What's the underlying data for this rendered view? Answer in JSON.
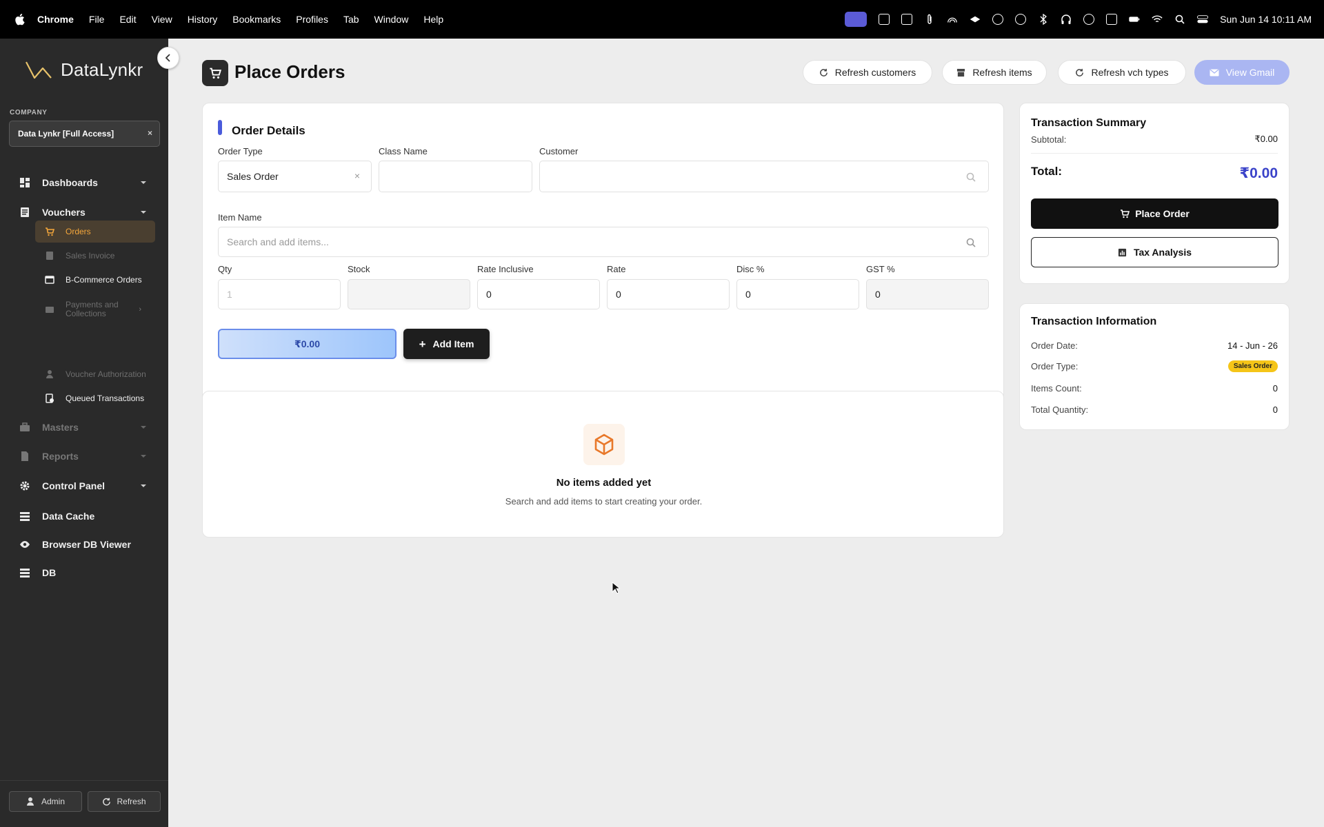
{
  "menubar": {
    "app": "Chrome",
    "items": [
      "File",
      "Edit",
      "View",
      "History",
      "Bookmarks",
      "Profiles",
      "Tab",
      "Window",
      "Help"
    ],
    "clock": "Sun Jun 14  10:11 AM"
  },
  "sidebar": {
    "brand": "DataLynkr",
    "company_label": "COMPANY",
    "company_value": "Data Lynkr [Full Access]",
    "nav": {
      "dashboards": "Dashboards",
      "vouchers": "Vouchers",
      "masters": "Masters",
      "reports": "Reports",
      "control_panel": "Control Panel",
      "data_cache": "Data Cache",
      "browser_db": "Browser DB Viewer",
      "db": "DB"
    },
    "sub": {
      "orders": "Orders",
      "sales_invoice": "Sales Invoice",
      "bcommerce": "B-Commerce Orders",
      "payments": "Payments and Collections",
      "voucher_auth": "Voucher Authorization",
      "queued": "Queued Transactions"
    },
    "bottom": {
      "admin": "Admin",
      "refresh": "Refresh"
    }
  },
  "header": {
    "title": "Place Orders",
    "refresh_customers": "Refresh customers",
    "refresh_items": "Refresh items",
    "refresh_vch": "Refresh vch types",
    "view_gmail": "View Gmail"
  },
  "order": {
    "section_title": "Order Details",
    "order_type_label": "Order Type",
    "order_type_value": "Sales Order",
    "class_label": "Class Name",
    "class_value": "",
    "customer_label": "Customer",
    "customer_value": "",
    "item_label": "Item Name",
    "item_placeholder": "Search and add items...",
    "qty_label": "Qty",
    "qty_placeholder": "1",
    "stock_label": "Stock",
    "stock_value": "",
    "rate_incl_label": "Rate Inclusive",
    "rate_incl_value": "0",
    "rate_label": "Rate",
    "rate_value": "0",
    "disc_label": "Disc %",
    "disc_value": "0",
    "gst_label": "GST %",
    "gst_value": "0",
    "line_total": "₹0.00",
    "add_item": "Add Item"
  },
  "empty": {
    "title": "No items added yet",
    "subtitle": "Search and add items to start creating your order."
  },
  "summary": {
    "title": "Transaction Summary",
    "subtotal_label": "Subtotal:",
    "subtotal_value": "₹0.00",
    "total_label": "Total:",
    "total_value": "₹0.00",
    "place_order": "Place Order",
    "tax_analysis": "Tax Analysis"
  },
  "info": {
    "title": "Transaction Information",
    "order_date_label": "Order Date:",
    "order_date_value": "14 - Jun - 26",
    "order_type_label": "Order Type:",
    "order_type_value": "Sales Order",
    "items_count_label": "Items Count:",
    "items_count_value": "0",
    "total_qty_label": "Total Quantity:",
    "total_qty_value": "0"
  },
  "colors": {
    "accent": "#4a5bdb",
    "active_nav": "#f5a73b",
    "badge": "#f5c518",
    "total": "#3b43c9"
  }
}
